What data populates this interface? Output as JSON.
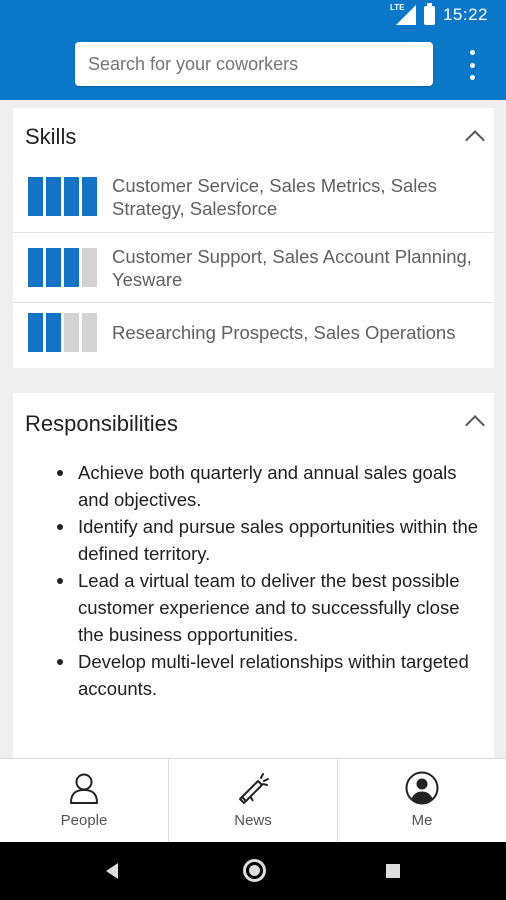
{
  "status_bar": {
    "network": "LTE",
    "time": "15:22"
  },
  "search": {
    "placeholder": "Search for your coworkers"
  },
  "skills": {
    "title": "Skills",
    "rows": [
      {
        "level": 4,
        "max": 4,
        "text": "Customer Service, Sales Metrics, Sales Strategy, Salesforce"
      },
      {
        "level": 3,
        "max": 4,
        "text": "Customer Support, Sales Account Planning, Yesware"
      },
      {
        "level": 2,
        "max": 4,
        "text": "Researching Prospects, Sales Operations"
      }
    ]
  },
  "responsibilities": {
    "title": "Responsibilities",
    "items": [
      "Achieve both quarterly and annual sales goals and objectives.",
      "Identify and pursue sales opportunities within the defined territory.",
      "Lead a virtual team to deliver the best possible customer experience and to successfully close the business opportunities.",
      "Develop multi-level relationships within targeted accounts."
    ]
  },
  "bottom_nav": {
    "people": "People",
    "news": "News",
    "me": "Me"
  },
  "colors": {
    "app_bar": "#0a78c8",
    "skill_bar_on": "#1374c4",
    "skill_bar_off": "#d3d3d3"
  }
}
